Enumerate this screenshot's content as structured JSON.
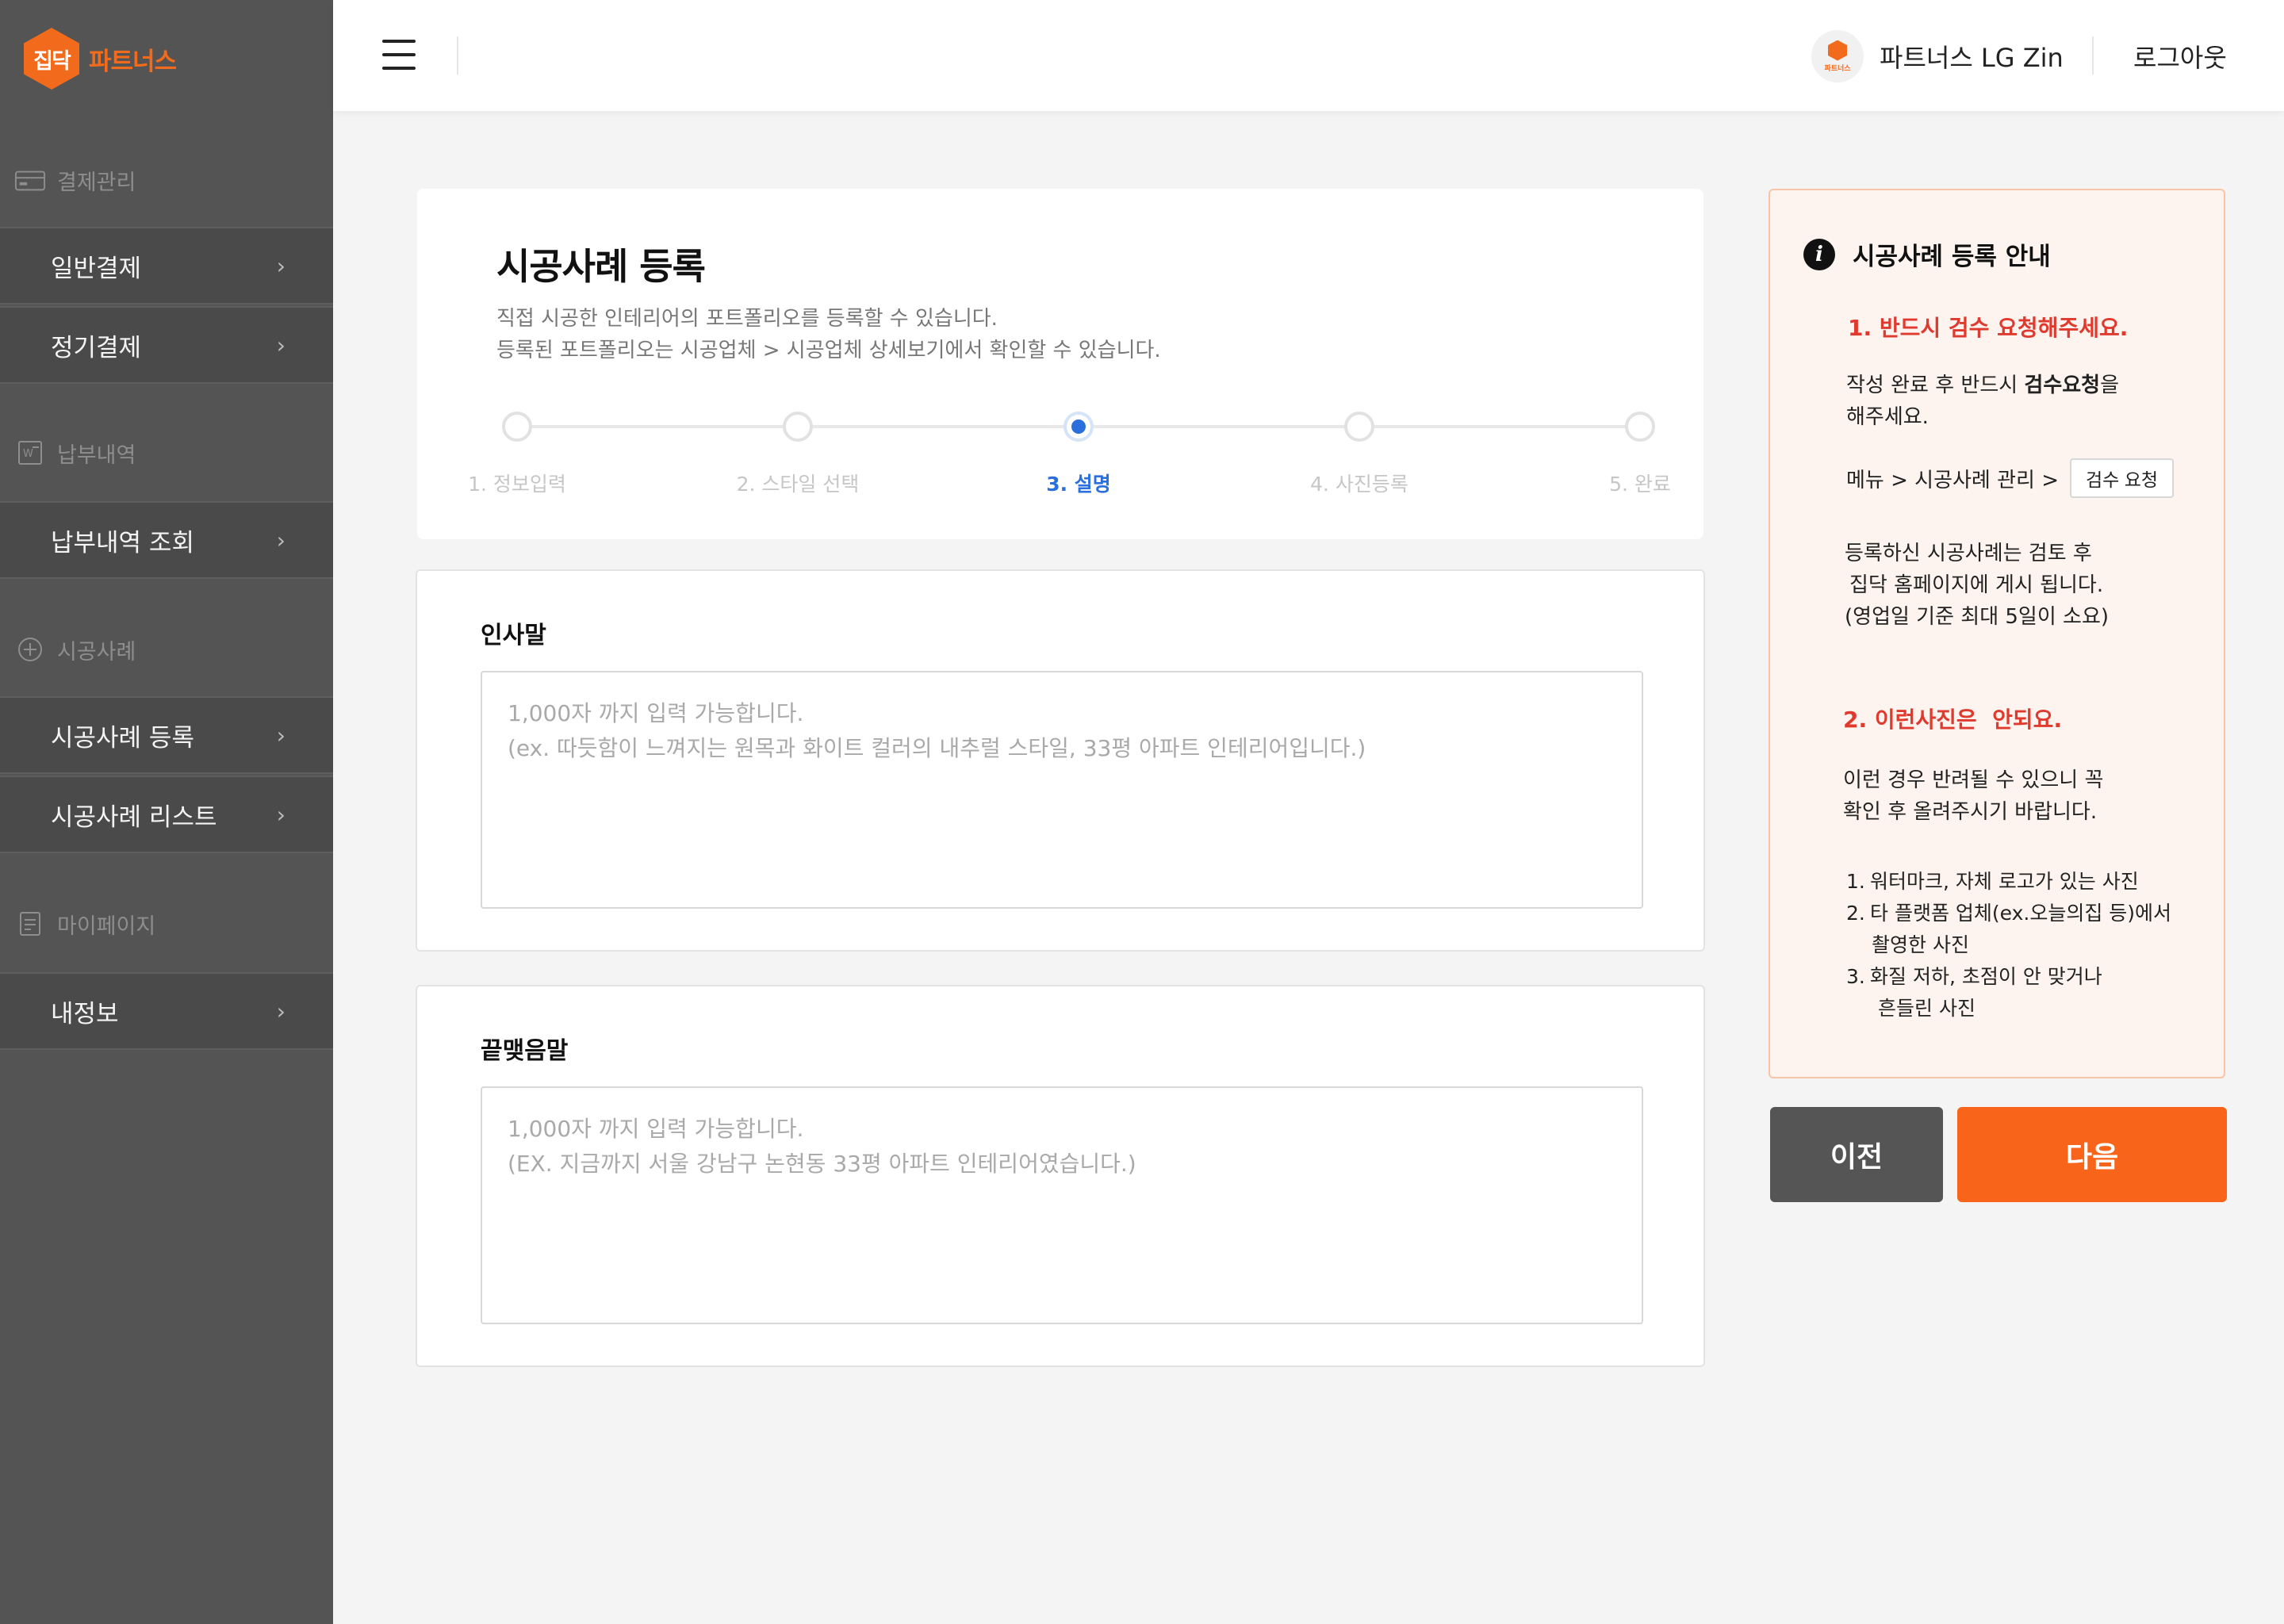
{
  "brand": {
    "logo_mark": "집닥",
    "logo_text": "파트너스",
    "accent": "#f26a1b"
  },
  "sidebar": {
    "sections": [
      {
        "label": "결제관리",
        "icon": "card-icon"
      },
      {
        "label": "납부내역",
        "icon": "receipt-icon"
      },
      {
        "label": "시공사례",
        "icon": "plus-circle-icon"
      },
      {
        "label": "마이페이지",
        "icon": "document-icon"
      }
    ],
    "items": [
      {
        "label": "일반결제",
        "chevron": "›"
      },
      {
        "label": "정기결제",
        "chevron": "›"
      },
      {
        "label": "납부내역 조회",
        "chevron": "›"
      },
      {
        "label": "시공사례 등록",
        "chevron": "›"
      },
      {
        "label": "시공사례 리스트",
        "chevron": "›"
      },
      {
        "label": "내정보",
        "chevron": "›"
      }
    ]
  },
  "header": {
    "avatar_text": "파트너스",
    "user_name": "파트너스 LG Zin",
    "logout": "로그아웃"
  },
  "page": {
    "title": "시공사례 등록",
    "desc_line1": "직접 시공한 인테리어의 포트폴리오를 등록할 수 있습니다.",
    "desc_line2": "등록된 포트폴리오는 시공업체 > 시공업체 상세보기에서 확인할 수 있습니다."
  },
  "stepper": {
    "steps": [
      {
        "label": "1. 정보입력",
        "state": "inactive"
      },
      {
        "label": "2. 스타일 선택",
        "state": "inactive"
      },
      {
        "label": "3. 설명",
        "state": "active"
      },
      {
        "label": "4. 사진등록",
        "state": "inactive"
      },
      {
        "label": "5. 완료",
        "state": "inactive"
      }
    ],
    "active_color": "#2a6fdb"
  },
  "greeting": {
    "label": "인사말",
    "value": "",
    "placeholder": "1,000자 까지 입력 가능합니다.\n(ex. 따듯함이 느껴지는 원목과 화이트 컬러의 내추럴 스타일, 33평 아파트 인테리어입니다.)"
  },
  "closing": {
    "label": "끝맺음말",
    "value": "",
    "placeholder": "1,000자 까지 입력 가능합니다.\n(EX. 지금까지 서울 강남구 논현동 33평 아파트 인테리어였습니다.)"
  },
  "guide": {
    "title": "시공사례 등록 안내",
    "section1_title": "1. 반드시 검수 요청해주세요.",
    "s1_text_a": "작성 완료 후 반드시 ",
    "s1_text_bold": "검수요청",
    "s1_text_b": "을",
    "s1_text_c": "해주세요.",
    "menu_path": "메뉴 > 시공사례 관리 >",
    "review_button": "검수 요청",
    "s1_note_1": "등록하신 시공사례는 검토 후",
    "s1_note_2": "집닥 홈페이지에 게시 됩니다.",
    "s1_note_3": "(영업일 기준 최대 5일이 소요)",
    "section2_title": "2. 이런사진은  안되요.",
    "s2_text_1": "이런 경우 반려될 수 있으니 꼭",
    "s2_text_2": "확인 후 올려주시기 바랍니다.",
    "list": [
      {
        "num": "1.",
        "line1": "워터마크, 자체 로고가 있는 사진",
        "line2": ""
      },
      {
        "num": "2.",
        "line1": "타 플랫폼 업체(ex.오늘의집 등)에서",
        "line2": "촬영한 사진"
      },
      {
        "num": "3.",
        "line1": "화질 저하, 초점이 안 맞거나",
        "line2": "흔들린 사진"
      }
    ],
    "bg_color": "#fdf4ef",
    "warn_color": "#e03a2f"
  },
  "actions": {
    "prev": "이전",
    "next": "다음",
    "next_color": "#f7641a",
    "prev_color": "#555555"
  }
}
